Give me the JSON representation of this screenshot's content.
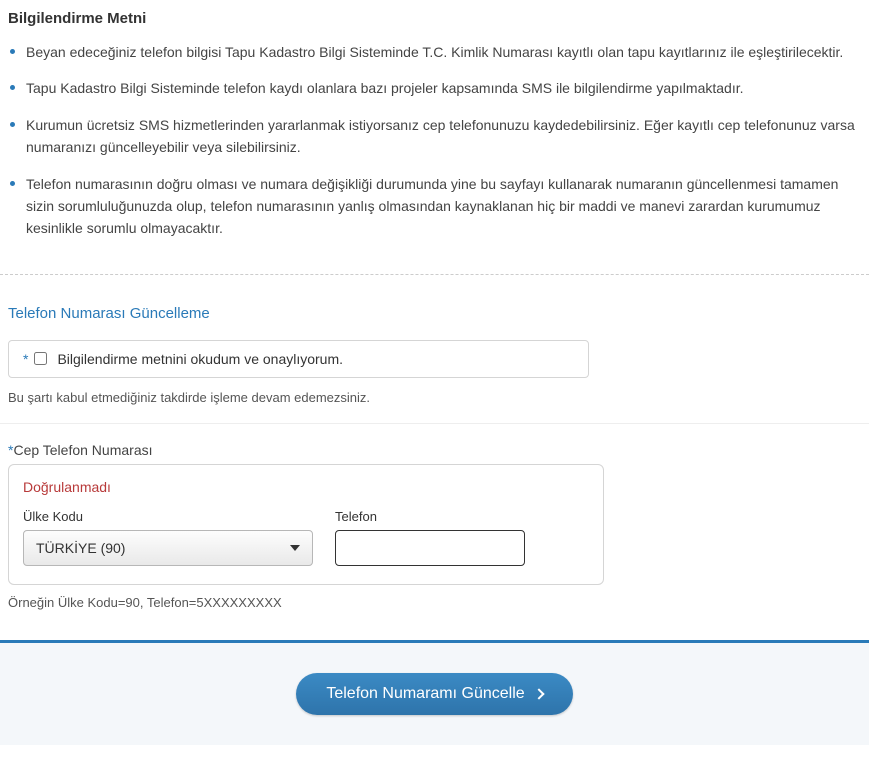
{
  "info": {
    "title": "Bilgilendirme Metni",
    "bullets": [
      "Beyan edeceğiniz telefon bilgisi Tapu Kadastro Bilgi Sisteminde T.C. Kimlik Numarası kayıtlı olan tapu kayıtlarınız ile eşleştirilecektir.",
      "Tapu Kadastro Bilgi Sisteminde telefon kaydı olanlara bazı projeler kapsamında SMS ile bilgilendirme yapılmaktadır.",
      "Kurumun ücretsiz SMS hizmetlerinden yararlanmak istiyorsanız cep telefonunuzu kaydedebilirsiniz. Eğer kayıtlı cep telefonunuz varsa numaranızı güncelleyebilir veya silebilirsiniz.",
      "Telefon numarasının doğru olması ve numara değişikliği durumunda yine bu sayfayı kullanarak numaranın güncellenmesi tamamen sizin sorumluluğunuzda olup, telefon numarasının yanlış olmasından kaynaklanan hiç bir maddi ve manevi zarardan kurumumuz kesinlikle sorumlu olmayacaktır."
    ]
  },
  "section": {
    "title": "Telefon Numarası Güncelleme"
  },
  "consent": {
    "asterisk": "*",
    "label": "Bilgilendirme metnini okudum ve onaylıyorum.",
    "note": "Bu şartı kabul etmediğiniz takdirde işleme devam edemezsiniz."
  },
  "phone": {
    "asterisk": "*",
    "label": "Cep Telefon Numarası",
    "status": "Doğrulanmadı",
    "country_label": "Ülke Kodu",
    "country_value": "TÜRKİYE (90)",
    "phone_label": "Telefon",
    "phone_value": "",
    "example": "Örneğin Ülke Kodu=90, Telefon=5XXXXXXXXX"
  },
  "actions": {
    "submit": "Telefon Numaramı Güncelle"
  }
}
